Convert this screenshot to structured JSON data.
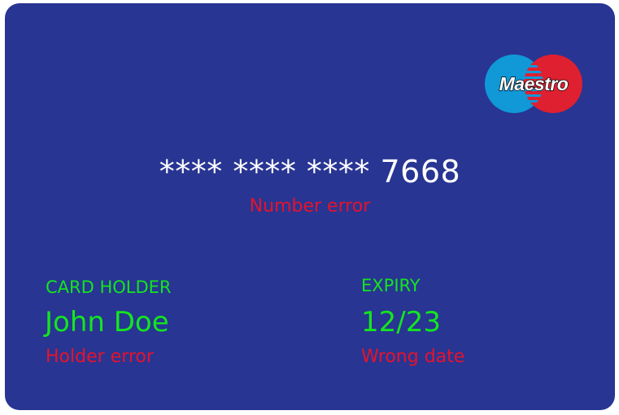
{
  "card": {
    "number": "**** **** **** 7668",
    "number_error": "Number error",
    "brand": {
      "name": "Maestro",
      "icon": "maestro-logo",
      "colors": {
        "left": "#1098d7",
        "right": "#df2030",
        "overlap": "#6c6bbd"
      }
    },
    "holder": {
      "label": "CARD HOLDER",
      "value": "John Doe",
      "error": "Holder error"
    },
    "expiry": {
      "label": "EXPIRY",
      "value": "12/23",
      "error": "Wrong date"
    },
    "colors": {
      "background": "#283593",
      "label_text": "#14e51e",
      "error_text": "#e6132b",
      "number_text": "#ffffff"
    }
  }
}
